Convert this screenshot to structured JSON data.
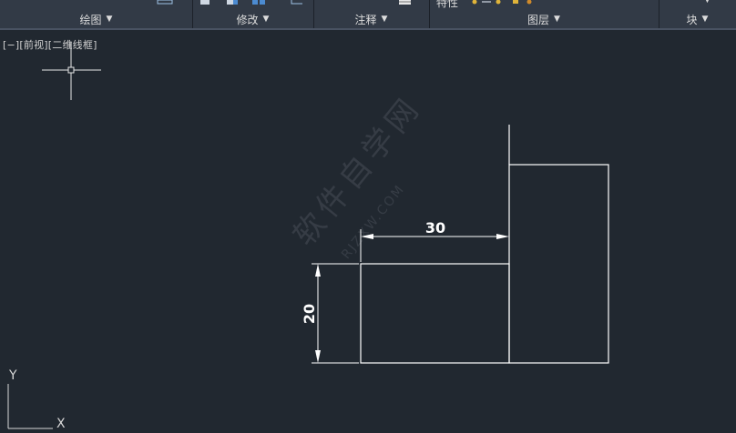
{
  "ribbon": {
    "groups": [
      {
        "label": "绘图"
      },
      {
        "label": "修改"
      },
      {
        "label": "注释"
      },
      {
        "label": "图层",
        "top_text": "特性"
      },
      {
        "label": "块"
      }
    ]
  },
  "viewport": {
    "label": "[−][前视][二维线框]"
  },
  "drawing": {
    "dim_horizontal": "30",
    "dim_vertical": "20"
  },
  "ucs": {
    "x_label": "X",
    "y_label": "Y"
  },
  "watermark": {
    "text": "软件自学网",
    "sub": "RJZXW.COM"
  },
  "colors": {
    "background": "#212830",
    "ribbon": "#323a46",
    "lines": "#ffffff",
    "accent_icon": "#e0b43a"
  }
}
